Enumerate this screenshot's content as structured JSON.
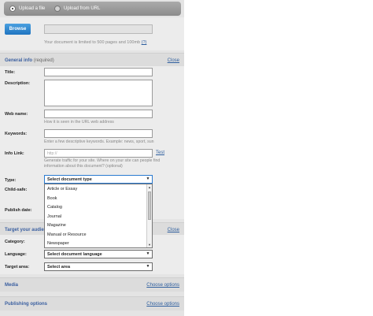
{
  "source": {
    "upload_file_label": "Upload a file",
    "upload_url_label": "Upload from URL",
    "selected": "file"
  },
  "upload": {
    "browse_label": "Browse",
    "limit_note": "Your document is limited to 500 pages and 100mb",
    "help_label": "(?)"
  },
  "general": {
    "title": "General info",
    "required_note": "(required)",
    "close_label": "Close",
    "title_label": "Title:",
    "description_label": "Description:",
    "web_name_label": "Web name:",
    "web_name_hint": "How it is seen in the URL web address",
    "keywords_label": "Keywords:",
    "keywords_hint": "Enter a few descriptive keywords. Example: news, sport, sun",
    "info_link_label": "Info Link:",
    "info_link_placeholder": "http://",
    "test_label": "Test",
    "info_link_hint": "Generate traffic for your site. Where on your site can people find information about this document? (optional)",
    "type_label": "Type:",
    "type_value": "Select document type",
    "child_safe_label": "Child-safe:",
    "publish_date_label": "Publish date:"
  },
  "type_options": [
    "Article or Essay",
    "Book",
    "Catalog",
    "Journal",
    "Magazine",
    "Manual or Resource",
    "Newspaper"
  ],
  "target": {
    "title": "Target your audie",
    "close_label": "Close",
    "category_label": "Category:",
    "language_label": "Language:",
    "language_value": "Select document language",
    "area_label": "Target area:",
    "area_value": "Select area"
  },
  "media": {
    "title": "Media",
    "link_label": "Choose options"
  },
  "publishing": {
    "title": "Publishing options",
    "link_label": "Choose options"
  }
}
